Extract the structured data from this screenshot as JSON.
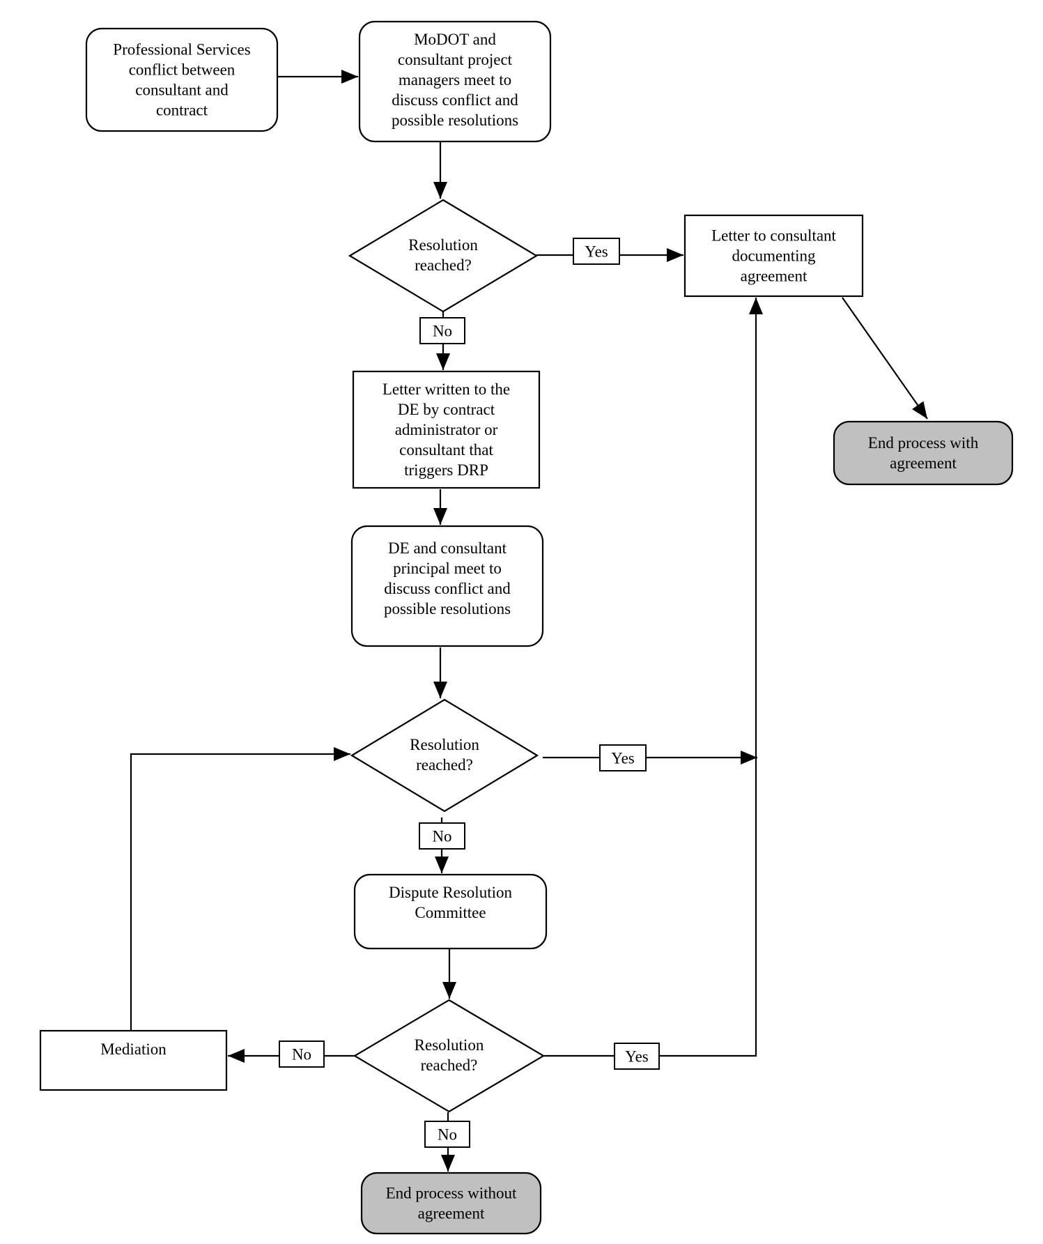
{
  "diagram": {
    "type": "flowchart",
    "colors": {
      "stroke": "#000000",
      "node_fill": "#ffffff",
      "terminal_fill": "#c0c0c0"
    },
    "nodes": [
      {
        "id": "start",
        "shape": "rounded",
        "lines": [
          "Professional Services",
          "conflict between",
          "consultant and",
          "contract"
        ]
      },
      {
        "id": "pm_meet",
        "shape": "rounded",
        "lines": [
          "MoDOT and",
          "consultant project",
          "managers meet to",
          "discuss conflict and",
          "possible resolutions"
        ]
      },
      {
        "id": "decision1",
        "shape": "diamond",
        "lines": [
          "Resolution",
          "reached?"
        ]
      },
      {
        "id": "letter_agree",
        "shape": "rect",
        "lines": [
          "Letter to consultant",
          "documenting",
          "agreement"
        ]
      },
      {
        "id": "end_agree",
        "shape": "terminal",
        "lines": [
          "End process with",
          "agreement"
        ]
      },
      {
        "id": "letter_de",
        "shape": "rect",
        "lines": [
          "Letter written to the",
          "DE by contract",
          "administrator or",
          "consultant that",
          "triggers DRP"
        ]
      },
      {
        "id": "de_meet",
        "shape": "rounded",
        "lines": [
          "DE and consultant",
          "principal meet to",
          "discuss conflict and",
          "possible resolutions"
        ]
      },
      {
        "id": "decision2",
        "shape": "diamond",
        "lines": [
          "Resolution",
          "reached?"
        ]
      },
      {
        "id": "drc",
        "shape": "rounded",
        "lines": [
          "Dispute Resolution",
          "Committee"
        ]
      },
      {
        "id": "decision3",
        "shape": "diamond",
        "lines": [
          "Resolution",
          "reached?"
        ]
      },
      {
        "id": "mediation",
        "shape": "rect",
        "lines": [
          "Mediation"
        ]
      },
      {
        "id": "end_no_agree",
        "shape": "terminal",
        "lines": [
          "End process without",
          "agreement"
        ]
      }
    ],
    "edges": [
      {
        "from": "start",
        "to": "pm_meet",
        "label": ""
      },
      {
        "from": "pm_meet",
        "to": "decision1",
        "label": ""
      },
      {
        "from": "decision1",
        "to": "letter_agree",
        "label": "Yes"
      },
      {
        "from": "decision1",
        "to": "letter_de",
        "label": "No"
      },
      {
        "from": "letter_agree",
        "to": "end_agree",
        "label": ""
      },
      {
        "from": "letter_de",
        "to": "de_meet",
        "label": ""
      },
      {
        "from": "de_meet",
        "to": "decision2",
        "label": ""
      },
      {
        "from": "decision2",
        "to": "letter_agree",
        "label": "Yes"
      },
      {
        "from": "decision2",
        "to": "drc",
        "label": "No"
      },
      {
        "from": "drc",
        "to": "decision3",
        "label": ""
      },
      {
        "from": "decision3",
        "to": "mediation",
        "label": "No"
      },
      {
        "from": "decision3",
        "to": "letter_agree",
        "label": "Yes"
      },
      {
        "from": "decision3",
        "to": "end_no_agree",
        "label": "No"
      },
      {
        "from": "mediation",
        "to": "decision2",
        "label": ""
      }
    ]
  }
}
